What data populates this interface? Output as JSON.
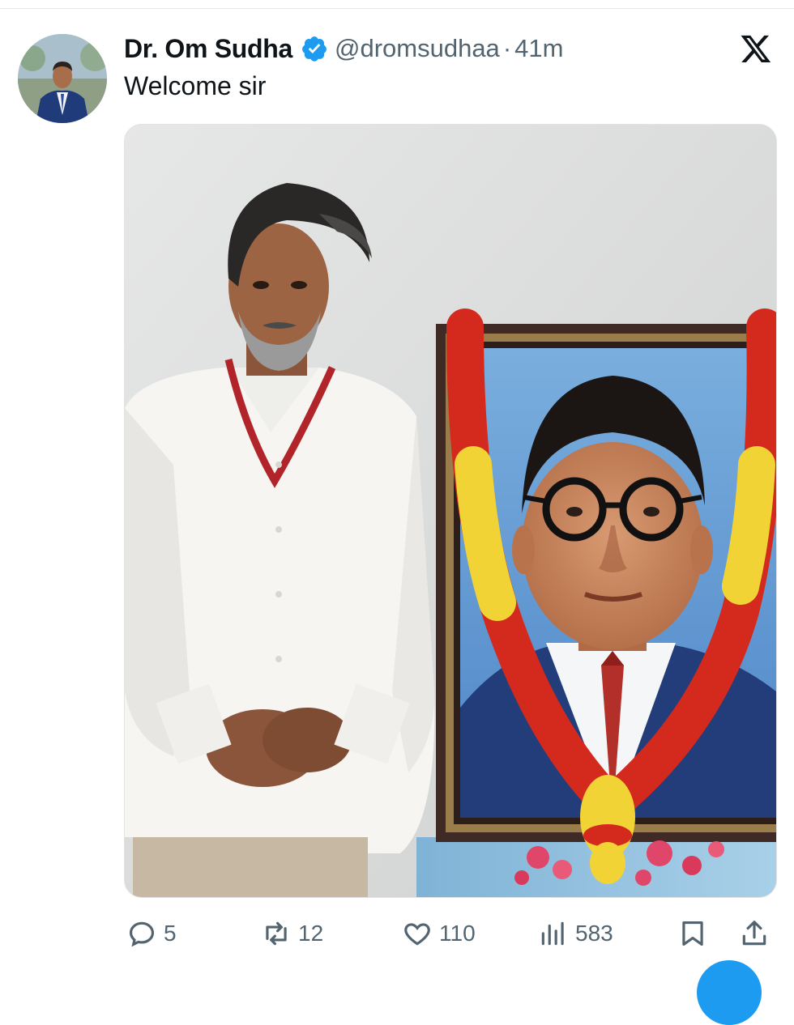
{
  "author": {
    "name": "Dr. Om Sudha",
    "handle": "@dromsudhaa",
    "separator": "·",
    "time": "41m",
    "verified": true
  },
  "tweet": {
    "text": "Welcome sir"
  },
  "media": {
    "type": "photo"
  },
  "actions": {
    "replies": "5",
    "reposts": "12",
    "likes": "110",
    "views": "583"
  },
  "icons": {
    "verified": "verified-badge-icon",
    "brand": "x-logo-icon",
    "reply": "reply-icon",
    "repost": "repost-icon",
    "like": "heart-icon",
    "views": "views-bar-chart-icon",
    "bookmark": "bookmark-icon",
    "share": "share-icon"
  },
  "colors": {
    "accent": "#1d9bf0",
    "text": "#0f1419",
    "muted": "#536471"
  }
}
